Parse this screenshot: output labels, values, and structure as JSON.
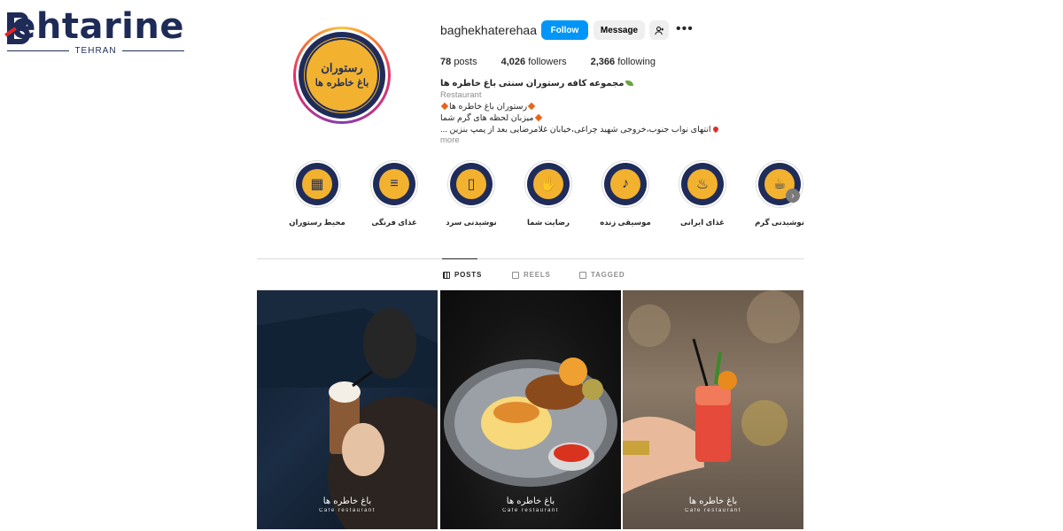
{
  "brand": {
    "name": "ehtarine",
    "city": "TEHRAN"
  },
  "profile": {
    "username": "baghekhaterehaa",
    "follow_label": "Follow",
    "message_label": "Message",
    "avatar_text_top": "رستوران",
    "avatar_text_bottom": "باغ خاطره ها"
  },
  "stats": {
    "posts_count": "78",
    "posts_label": "posts",
    "followers_count": "4,026",
    "followers_label": "followers",
    "following_count": "2,366",
    "following_label": "following"
  },
  "bio": {
    "full_name": "مجموعه کافه رستوران سنتی باغ خاطره ها",
    "category": "Restaurant",
    "line1": "رستوران باغ خاطره ها",
    "line2": "میزبان لحظه های گرم شما",
    "line3": "انتهای نواب جنوب،خروجی شهید چراغی،خیابان غلامرضایی بعد از پمپ بنزین ...",
    "more_label": "more"
  },
  "highlights": [
    {
      "label": "محیط رستوران",
      "icon": "building-icon",
      "glyph": "▦"
    },
    {
      "label": "غذای فرنگی",
      "icon": "burger-icon",
      "glyph": "≡"
    },
    {
      "label": "نوشیدنی سرد",
      "icon": "cold-drink-icon",
      "glyph": "▯"
    },
    {
      "label": "رضایت شما",
      "icon": "handshake-icon",
      "glyph": "✋"
    },
    {
      "label": "موسیقی زنده",
      "icon": "music-note-icon",
      "glyph": "♪"
    },
    {
      "label": "غذای ایرانی",
      "icon": "dish-icon",
      "glyph": "♨"
    },
    {
      "label": "نوشیدنی گرم",
      "icon": "hot-cup-icon",
      "glyph": "☕"
    }
  ],
  "tabs": [
    {
      "label": "POSTS",
      "active": true,
      "icon": "grid-icon"
    },
    {
      "label": "REELS",
      "active": false,
      "icon": "reels-icon"
    },
    {
      "label": "TAGGED",
      "active": false,
      "icon": "tagged-icon"
    }
  ],
  "posts": [
    {
      "caption_fa": "باغ خاطره ها",
      "caption_en": "Cafe restaurant",
      "subject": "coffee-drink"
    },
    {
      "caption_fa": "باغ خاطره ها",
      "caption_en": "Cafe restaurant",
      "subject": "rice-chicken-plate"
    },
    {
      "caption_fa": "باغ خاطره ها",
      "caption_en": "Cafe restaurant",
      "subject": "red-cocktail"
    }
  ],
  "colors": {
    "follow_blue": "#0095f6",
    "brand_navy": "#1f2c5a",
    "brand_gold": "#f2b22f"
  }
}
